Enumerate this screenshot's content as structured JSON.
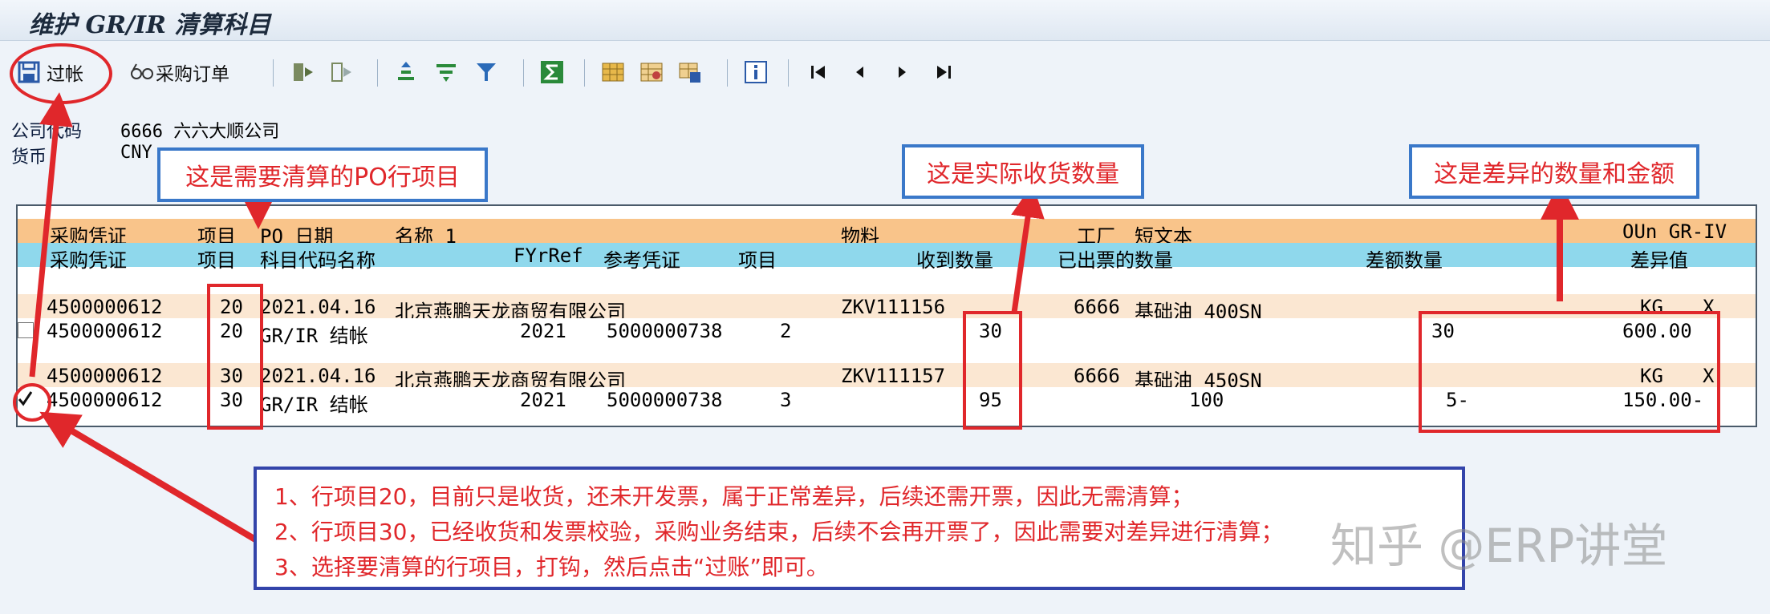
{
  "window": {
    "title": "维护 GR/IR 清算科目"
  },
  "toolbar": {
    "post_label": "过帐",
    "po_label": "采购订单",
    "icons": [
      "save-icon",
      "glasses-icon",
      "select-all-icon",
      "deselect-all-icon",
      "sort-asc-icon",
      "filter-icon",
      "funnel-icon",
      "sum-icon",
      "layout-icon",
      "layout-change-icon",
      "layout-save-icon",
      "info-icon",
      "first-page-icon",
      "prev-page-icon",
      "next-page-icon",
      "last-page-icon"
    ]
  },
  "header": {
    "company_label": "公司代码",
    "company_value": "6666 六六大顺公司",
    "currency_label": "货币",
    "currency_value": "CNY"
  },
  "grid": {
    "header1": {
      "c1": "采购凭证",
      "c2": "项目",
      "c3": "PO 日期",
      "c4": "名称 1",
      "c5": "物料",
      "c6": "工厂",
      "c7": "短文本",
      "c8": "OUn GR-IV"
    },
    "header2": {
      "c1": "采购凭证",
      "c2": "项目",
      "c3": "科目代码名称",
      "c4": "FYrRef",
      "c5": "参考凭证",
      "c6": "项目",
      "c7": "收到数量",
      "c8": "已出票的数量",
      "c9": "差额数量",
      "c10": "差异值"
    },
    "items": [
      {
        "po": "4500000612",
        "item": "20",
        "date": "2021.04.16",
        "vendor": "北京燕鹏天龙商贸有限公司",
        "material": "ZKV111156",
        "plant": "6666",
        "short_text": "基础油 400SN",
        "unit": "KG",
        "flag": "X",
        "acct": "GR/IR 结帐",
        "fyr": "2021",
        "ref_doc": "5000000738",
        "ref_item": "2",
        "received": "30",
        "invoiced": "",
        "diff_qty": "30",
        "diff_val": "600.00",
        "checked": false
      },
      {
        "po": "4500000612",
        "item": "30",
        "date": "2021.04.16",
        "vendor": "北京燕鹏天龙商贸有限公司",
        "material": "ZKV111157",
        "plant": "6666",
        "short_text": "基础油 450SN",
        "unit": "KG",
        "flag": "X",
        "acct": "GR/IR 结帐",
        "fyr": "2021",
        "ref_doc": "5000000738",
        "ref_item": "3",
        "received": "95",
        "invoiced": "100",
        "diff_qty": "5-",
        "diff_val": "150.00-",
        "checked": true
      }
    ]
  },
  "annotations": {
    "po_item": "这是需要清算的PO行项目",
    "received": "这是实际收货数量",
    "diff": "这是差异的数量和金额",
    "note1": "1、行项目20，目前只是收货，还未开发票，属于正常差异，后续还需开票，因此无需清算；",
    "note2": "2、行项目30，已经收货和发票校验，采购业务结束，后续不会再开票了，因此需要对差异进行清算；",
    "note3": "3、选择要清算的行项目，打钩，然后点击“过账”即可。"
  },
  "watermark": "知乎 @ERP讲堂",
  "colors": {
    "header_orange": "#f9c48a",
    "header_cyan": "#8fd8ec",
    "row_orange": "#fbe7d2",
    "annotation_red": "#e0272b",
    "annotation_blue": "#3a78c9"
  }
}
